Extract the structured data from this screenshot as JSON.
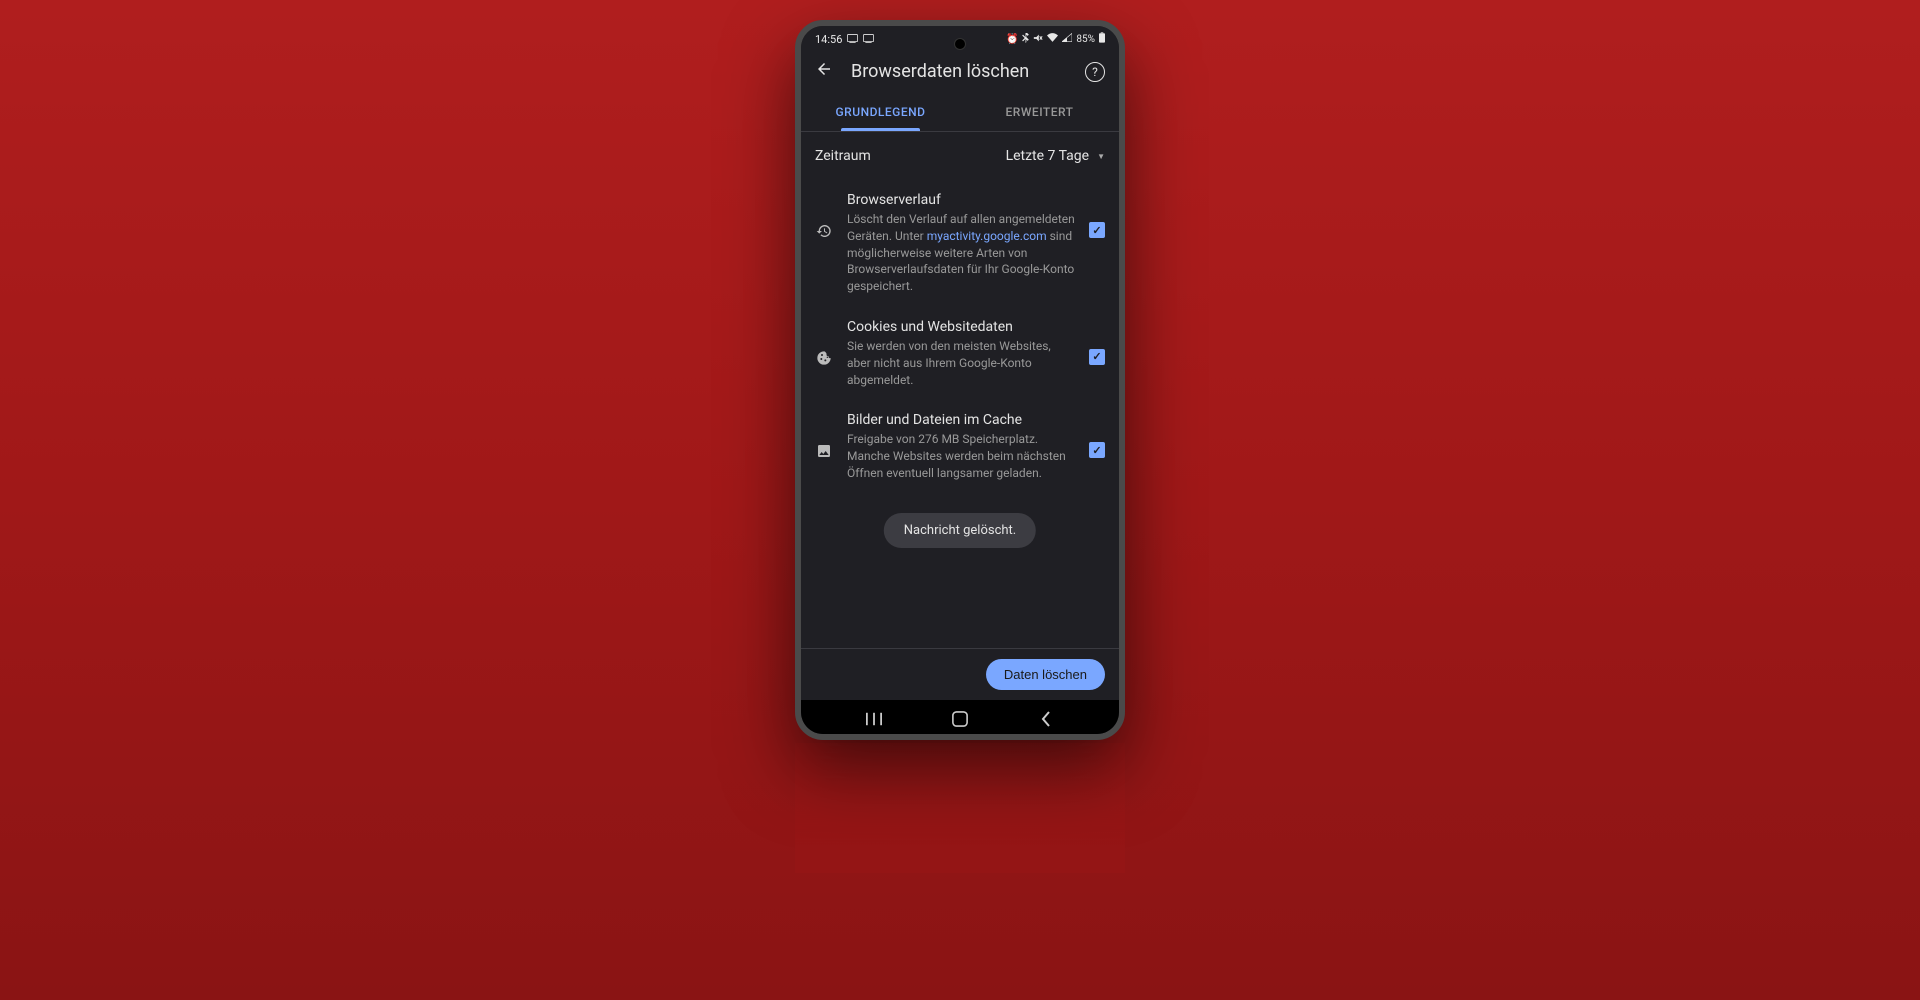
{
  "status": {
    "time": "14:56",
    "battery": "85%"
  },
  "header": {
    "title": "Browserdaten löschen"
  },
  "tabs": {
    "basic": "GRUNDLEGEND",
    "advanced": "ERWEITERT"
  },
  "timeRange": {
    "label": "Zeitraum",
    "value": "Letzte 7 Tage"
  },
  "options": {
    "history": {
      "title": "Browserverlauf",
      "desc1": "Löscht den Verlauf auf allen angemeldeten Geräten. Unter ",
      "link": "myactivity.google.com",
      "desc2": " sind möglicherweise weitere Arten von Browserverlaufsdaten für Ihr Google-Konto gespeichert."
    },
    "cookies": {
      "title": "Cookies und Websitedaten",
      "desc": "Sie werden von den meisten Websites, aber nicht aus Ihrem Google-Konto abgemeldet."
    },
    "cache": {
      "title": "Bilder und Dateien im Cache",
      "desc": "Freigabe von 276 MB Speicherplatz. Manche Websites werden beim nächsten Öffnen eventuell langsamer geladen."
    }
  },
  "toast": "Nachricht gelöscht.",
  "action": "Daten löschen"
}
